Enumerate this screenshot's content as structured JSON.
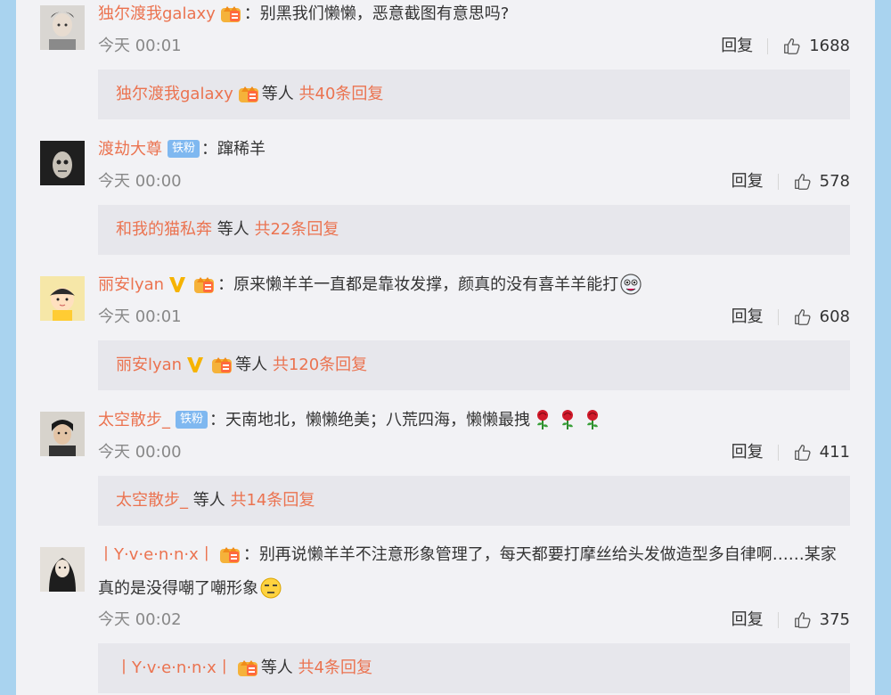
{
  "colors": {
    "username": "#eb7350",
    "text": "#333333",
    "time": "#888888",
    "reply_bg": "#e7e7ec",
    "page_bg": "#f2f2f5",
    "fan_badge": "#7fb8f0"
  },
  "comments": [
    {
      "username": "独尔渡我galaxy",
      "text": "别黑我们懒懒，恶意截图有意思吗?",
      "time": "今天 00:01",
      "reply_label": "回复",
      "likes": "1688",
      "thread_user": "独尔渡我galaxy",
      "thread_etc": "等人",
      "thread_total": "共40条回复"
    },
    {
      "username": "渡劫大尊",
      "fan_badge": "铁粉",
      "text": "蹿稀羊",
      "time": "今天 00:00",
      "reply_label": "回复",
      "likes": "578",
      "thread_user": "和我的猫私奔",
      "thread_etc": "等人",
      "thread_total": "共22条回复"
    },
    {
      "username": "丽安lyan",
      "text": "原来懒羊羊一直都是靠妆发撑，颜真的没有喜羊羊能打",
      "time": "今天 00:01",
      "reply_label": "回复",
      "likes": "608",
      "thread_user": "丽安lyan",
      "thread_etc": "等人",
      "thread_total": "共120条回复"
    },
    {
      "username": "太空散步_",
      "fan_badge": "铁粉",
      "text": "天南地北，懒懒绝美；八荒四海，懒懒最拽",
      "time": "今天 00:00",
      "reply_label": "回复",
      "likes": "411",
      "thread_user": "太空散步_",
      "thread_etc": "等人",
      "thread_total": "共14条回复"
    },
    {
      "username": "丨Y·v·e·n·n·x丨",
      "text": "别再说懒羊羊不注意形象管理了，每天都要打摩丝给头发做造型多自律啊……某家真的是没得嘲了嘲形象",
      "time": "今天 00:02",
      "reply_label": "回复",
      "likes": "375",
      "thread_user": "丨Y·v·e·n·n·x丨",
      "thread_etc": "等人",
      "thread_total": "共4条回复"
    }
  ]
}
